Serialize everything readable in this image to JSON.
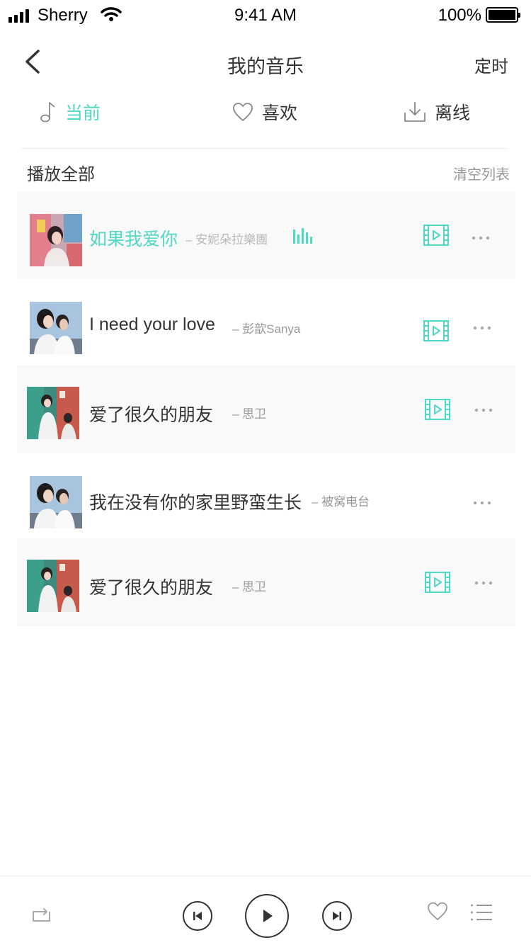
{
  "status_bar": {
    "carrier": "Sherry",
    "time": "9:41 AM",
    "battery": "100%"
  },
  "nav": {
    "title": "我的音乐",
    "right_label": "定时"
  },
  "tabs": [
    {
      "label": "当前",
      "icon": "music-note-icon",
      "active": true
    },
    {
      "label": "喜欢",
      "icon": "heart-icon",
      "active": false
    },
    {
      "label": "离线",
      "icon": "download-icon",
      "active": false
    }
  ],
  "list_header": {
    "play_all": "播放全部",
    "clear": "清空列表"
  },
  "songs": [
    {
      "title": "如果我爱你",
      "artist": "– 安妮朵拉樂團",
      "playing": true,
      "has_mv": true
    },
    {
      "title": "I need your love",
      "artist": "– 彭歆Sanya",
      "playing": false,
      "has_mv": true
    },
    {
      "title": "爱了很久的朋友",
      "artist": "– 思卫",
      "playing": false,
      "has_mv": true
    },
    {
      "title": "我在没有你的家里野蛮生长",
      "artist": "– 被窝电台",
      "playing": false,
      "has_mv": false
    },
    {
      "title": "爱了很久的朋友",
      "artist": "– 思卫",
      "playing": false,
      "has_mv": true
    }
  ],
  "player": {
    "icons": [
      "repeat-icon",
      "previous-icon",
      "play-icon",
      "next-icon",
      "heart-icon",
      "playlist-icon"
    ]
  },
  "colors": {
    "accent": "#4fd9c4",
    "text": "#333333",
    "muted": "#999999",
    "row_shade": "#f9f9f9"
  }
}
